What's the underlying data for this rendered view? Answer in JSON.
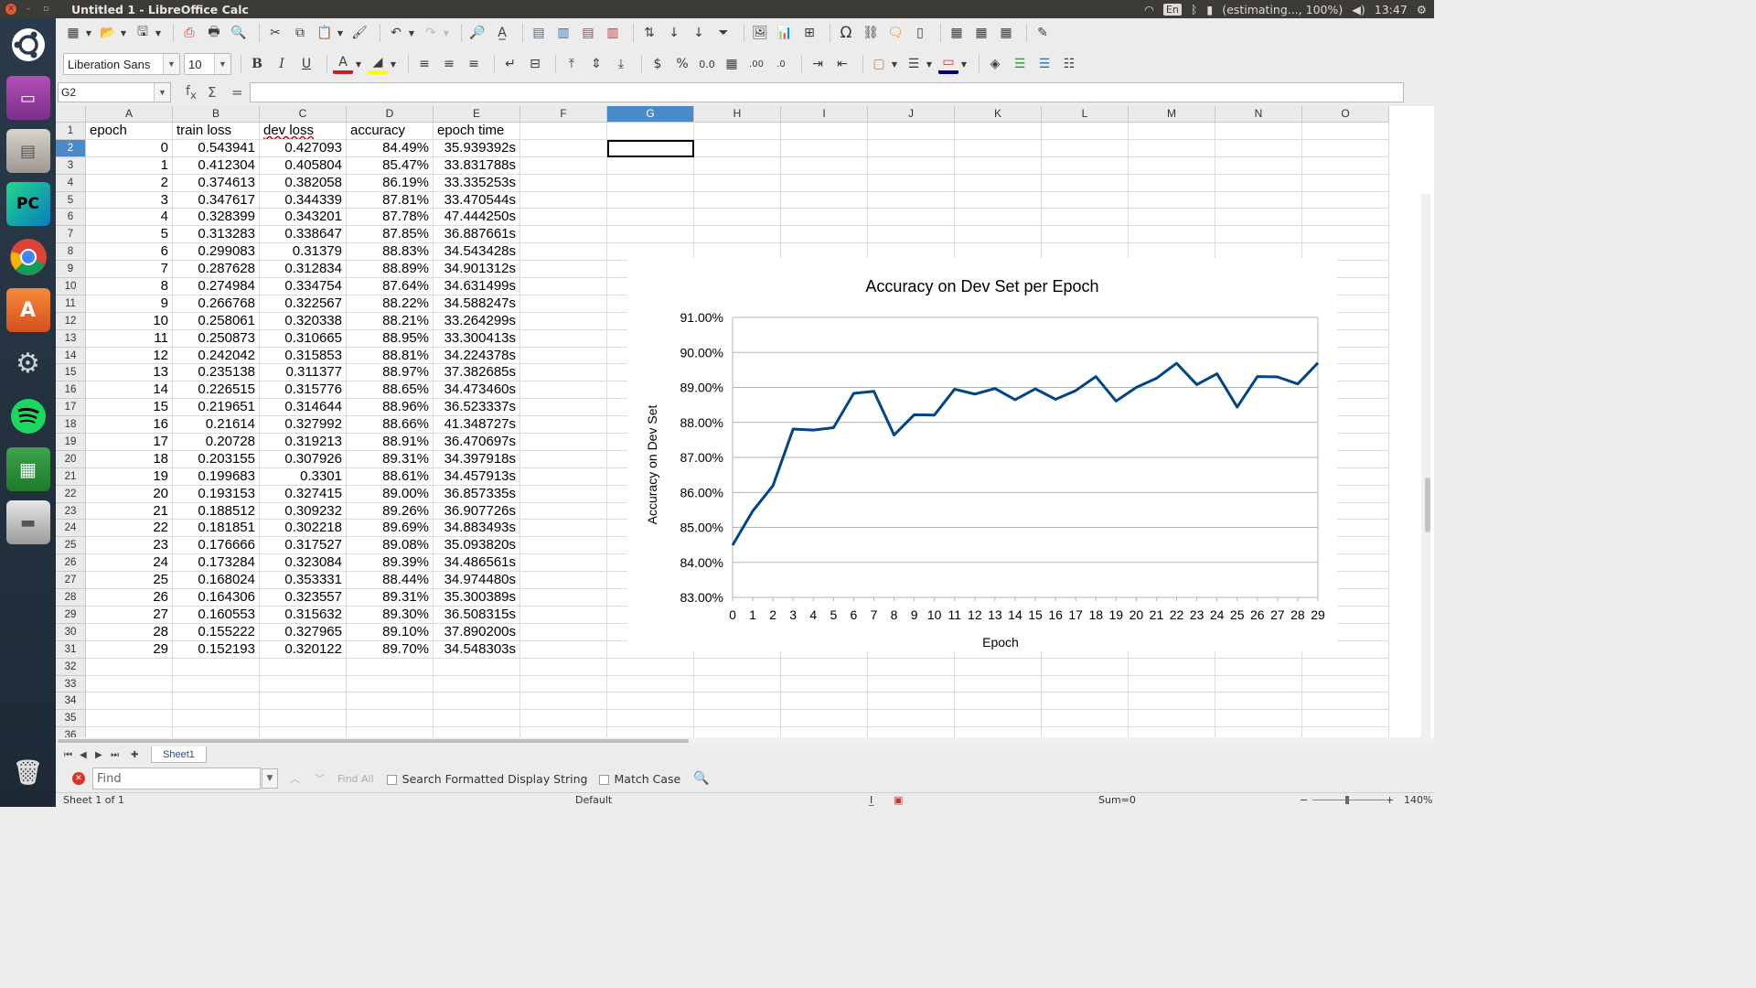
{
  "window": {
    "title": "Untitled 1 - LibreOffice Calc"
  },
  "tray": {
    "lang": "En",
    "battery": "(estimating..., 100%)",
    "clock": "13:47"
  },
  "launcher": [
    "ubuntu-dash",
    "files-manager",
    "file-cabinet",
    "pycharm",
    "chrome",
    "software-center",
    "system-settings",
    "spotify",
    "calc",
    "disk",
    "trash"
  ],
  "toolbar2": {
    "font_name": "Liberation Sans",
    "font_size": "10"
  },
  "formula": {
    "name_box": "G2",
    "content": ""
  },
  "columns": [
    "A",
    "B",
    "C",
    "D",
    "E",
    "F",
    "G",
    "H",
    "I",
    "J",
    "K",
    "L",
    "M",
    "N",
    "O"
  ],
  "selected_cell": "G2",
  "sheet": {
    "headers": [
      "epoch",
      "train loss",
      "dev loss",
      "accuracy",
      "epoch time"
    ],
    "rows": [
      [
        "0",
        "0.543941",
        "0.427093",
        "84.49%",
        "35.939392s"
      ],
      [
        "1",
        "0.412304",
        "0.405804",
        "85.47%",
        "33.831788s"
      ],
      [
        "2",
        "0.374613",
        "0.382058",
        "86.19%",
        "33.335253s"
      ],
      [
        "3",
        "0.347617",
        "0.344339",
        "87.81%",
        "33.470544s"
      ],
      [
        "4",
        "0.328399",
        "0.343201",
        "87.78%",
        "47.444250s"
      ],
      [
        "5",
        "0.313283",
        "0.338647",
        "87.85%",
        "36.887661s"
      ],
      [
        "6",
        "0.299083",
        "0.31379",
        "88.83%",
        "34.543428s"
      ],
      [
        "7",
        "0.287628",
        "0.312834",
        "88.89%",
        "34.901312s"
      ],
      [
        "8",
        "0.274984",
        "0.334754",
        "87.64%",
        "34.631499s"
      ],
      [
        "9",
        "0.266768",
        "0.322567",
        "88.22%",
        "34.588247s"
      ],
      [
        "10",
        "0.258061",
        "0.320338",
        "88.21%",
        "33.264299s"
      ],
      [
        "11",
        "0.250873",
        "0.310665",
        "88.95%",
        "33.300413s"
      ],
      [
        "12",
        "0.242042",
        "0.315853",
        "88.81%",
        "34.224378s"
      ],
      [
        "13",
        "0.235138",
        "0.311377",
        "88.97%",
        "37.382685s"
      ],
      [
        "14",
        "0.226515",
        "0.315776",
        "88.65%",
        "34.473460s"
      ],
      [
        "15",
        "0.219651",
        "0.314644",
        "88.96%",
        "36.523337s"
      ],
      [
        "16",
        "0.21614",
        "0.327992",
        "88.66%",
        "41.348727s"
      ],
      [
        "17",
        "0.20728",
        "0.319213",
        "88.91%",
        "36.470697s"
      ],
      [
        "18",
        "0.203155",
        "0.307926",
        "89.31%",
        "34.397918s"
      ],
      [
        "19",
        "0.199683",
        "0.3301",
        "88.61%",
        "34.457913s"
      ],
      [
        "20",
        "0.193153",
        "0.327415",
        "89.00%",
        "36.857335s"
      ],
      [
        "21",
        "0.188512",
        "0.309232",
        "89.26%",
        "36.907726s"
      ],
      [
        "22",
        "0.181851",
        "0.302218",
        "89.69%",
        "34.883493s"
      ],
      [
        "23",
        "0.176666",
        "0.317527",
        "89.08%",
        "35.093820s"
      ],
      [
        "24",
        "0.173284",
        "0.323084",
        "89.39%",
        "34.486561s"
      ],
      [
        "25",
        "0.168024",
        "0.353331",
        "88.44%",
        "34.974480s"
      ],
      [
        "26",
        "0.164306",
        "0.323557",
        "89.31%",
        "35.300389s"
      ],
      [
        "27",
        "0.160553",
        "0.315632",
        "89.30%",
        "36.508315s"
      ],
      [
        "28",
        "0.155222",
        "0.327965",
        "89.10%",
        "37.890200s"
      ],
      [
        "29",
        "0.152193",
        "0.320122",
        "89.70%",
        "34.548303s"
      ]
    ]
  },
  "chart_data": {
    "type": "line",
    "title": "Accuracy on Dev Set per Epoch",
    "xlabel": "Epoch",
    "ylabel": "Accuracy on Dev Set",
    "x": [
      0,
      1,
      2,
      3,
      4,
      5,
      6,
      7,
      8,
      9,
      10,
      11,
      12,
      13,
      14,
      15,
      16,
      17,
      18,
      19,
      20,
      21,
      22,
      23,
      24,
      25,
      26,
      27,
      28,
      29
    ],
    "series": [
      {
        "values": [
          84.49,
          85.47,
          86.19,
          87.81,
          87.78,
          87.85,
          88.83,
          88.89,
          87.64,
          88.22,
          88.21,
          88.95,
          88.81,
          88.97,
          88.65,
          88.96,
          88.66,
          88.91,
          89.31,
          88.61,
          89.0,
          89.26,
          89.69,
          89.08,
          89.39,
          88.44,
          89.31,
          89.3,
          89.1,
          89.7
        ],
        "color": "#004586"
      }
    ],
    "ylim": [
      83,
      91
    ],
    "yticks": [
      "83.00%",
      "84.00%",
      "85.00%",
      "86.00%",
      "87.00%",
      "88.00%",
      "89.00%",
      "90.00%",
      "91.00%"
    ],
    "grid": true,
    "legend": "none"
  },
  "sheet_tabs": [
    "Sheet1"
  ],
  "findbar": {
    "placeholder": "Find",
    "find_all": "Find All",
    "formatted": "Search Formatted Display String",
    "match_case": "Match Case"
  },
  "status": {
    "sheet": "Sheet 1 of 1",
    "style": "Default",
    "sum": "Sum=0",
    "zoom": "140%"
  }
}
